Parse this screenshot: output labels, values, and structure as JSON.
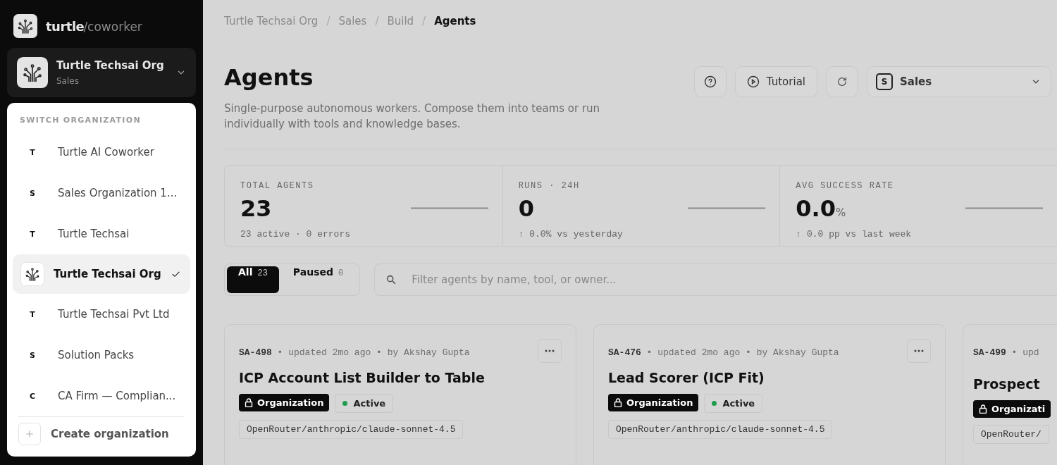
{
  "brand": {
    "name": "turtle",
    "suffix": "/coworker"
  },
  "org_switcher": {
    "name": "Turtle Techsai Org",
    "sub": "Sales"
  },
  "org_menu": {
    "heading": "SWITCH ORGANIZATION",
    "items": [
      {
        "kind": "letter",
        "initial": "T",
        "name": "Turtle AI Coworker",
        "selected": false
      },
      {
        "kind": "letter",
        "initial": "S",
        "name": "Sales Organization 1...",
        "selected": false
      },
      {
        "kind": "letter",
        "initial": "T",
        "name": "Turtle Techsai",
        "selected": false
      },
      {
        "kind": "logo",
        "name": "Turtle Techsai Org",
        "selected": true
      },
      {
        "kind": "letter",
        "initial": "T",
        "name": "Turtle Techsai Pvt Ltd",
        "selected": false
      },
      {
        "kind": "letter",
        "initial": "S",
        "name": "Solution Packs",
        "selected": false
      },
      {
        "kind": "letter",
        "initial": "C",
        "name": "CA Firm — Complian...",
        "selected": false
      }
    ],
    "create": "Create organization"
  },
  "breadcrumb": {
    "separator": "/",
    "items": [
      "Turtle Techsai Org",
      "Sales",
      "Build",
      "Agents"
    ]
  },
  "header": {
    "title": "Agents",
    "description": "Single-purpose autonomous workers. Compose them into teams or run individually with tools and knowledge bases.",
    "tutorial": "Tutorial",
    "workspace": {
      "initial": "S",
      "name": "Sales"
    }
  },
  "stats": [
    {
      "label": "TOTAL AGENTS",
      "value": "23",
      "sub": "23 active · 0 errors"
    },
    {
      "label": "RUNS · 24H",
      "value": "0",
      "sub": "↑ 0.0% vs yesterday"
    },
    {
      "label": "AVG SUCCESS RATE",
      "value": "0.0",
      "unit": "%",
      "sub": "↑ 0.0 pp vs last week"
    }
  ],
  "filters": [
    {
      "label": "All",
      "count": "23",
      "selected": true
    },
    {
      "label": "Paused",
      "count": "0",
      "selected": false
    }
  ],
  "search": {
    "placeholder": "Filter agents by name, tool, or owner..."
  },
  "agents": [
    {
      "meta": "**SA-498** • updated 2mo ago • by Akshay Gupta",
      "title": "ICP Account List Builder to Table",
      "visibility": "Organization",
      "status": "Active",
      "model": "OpenRouter/anthropic/claude-sonnet-4.5"
    },
    {
      "meta": "**SA-476** • updated 2mo ago • by Akshay Gupta",
      "title": "Lead Scorer (ICP Fit)",
      "visibility": "Organization",
      "status": "Active",
      "model": "OpenRouter/anthropic/claude-sonnet-4.5"
    },
    {
      "meta": "**SA-499** • upd",
      "title": "Prospect",
      "visibility": "Organizati",
      "model": "OpenRouter/"
    }
  ]
}
